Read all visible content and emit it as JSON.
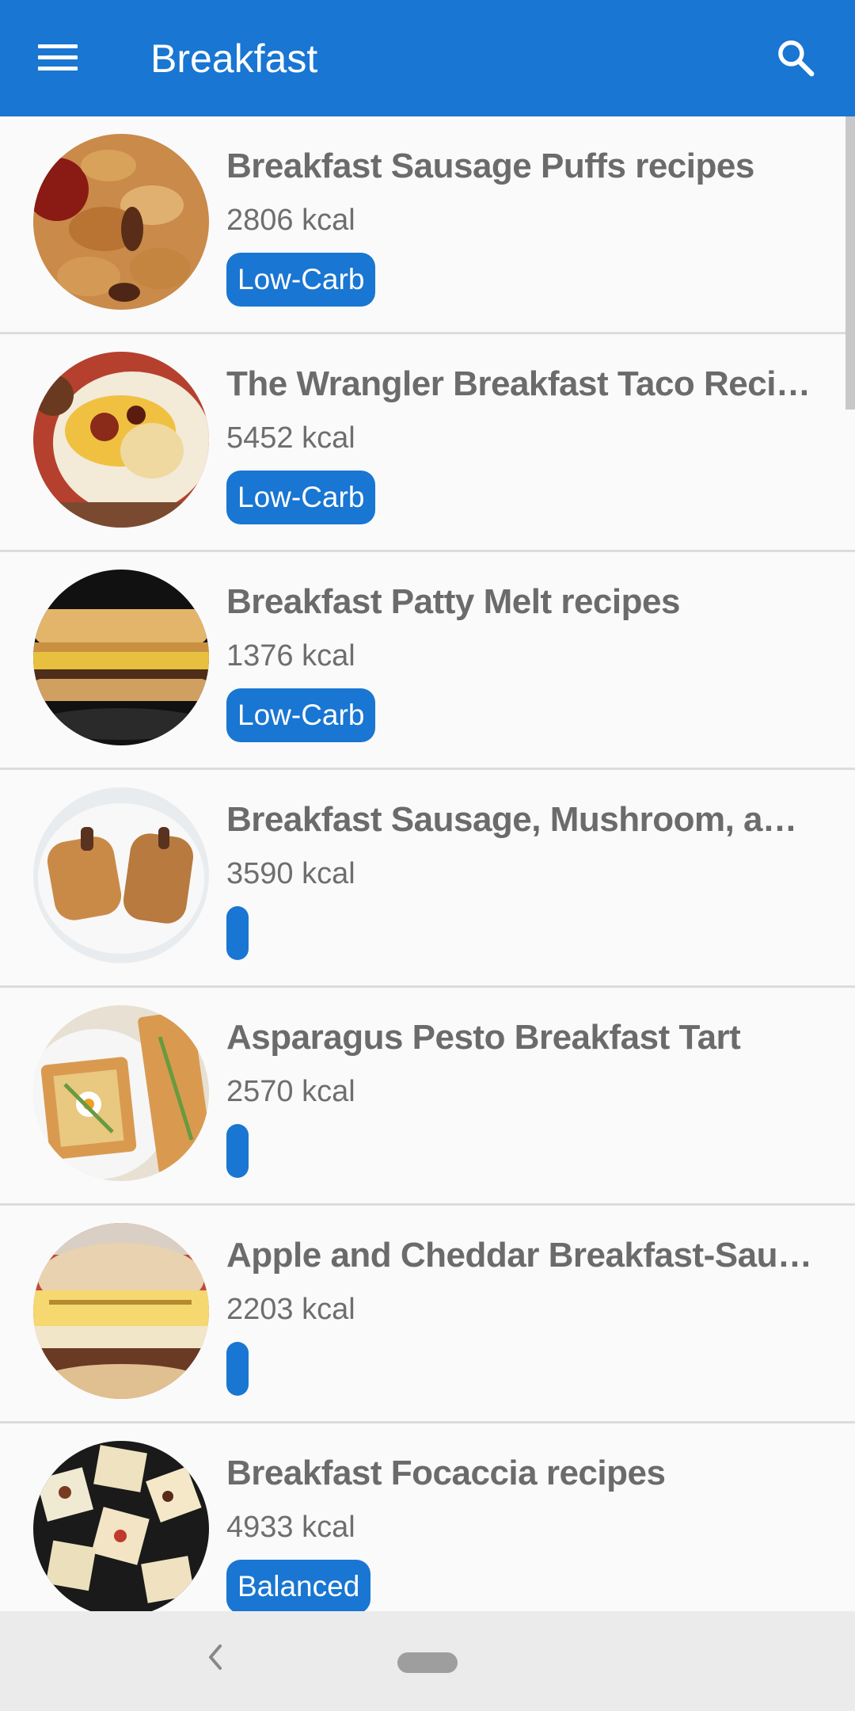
{
  "appbar": {
    "title": "Breakfast",
    "menu_icon": "menu-icon",
    "search_icon": "search-icon"
  },
  "recipes": [
    {
      "title": "Breakfast Sausage Puffs recipes",
      "kcal": "2806 kcal",
      "label": "Low-Carb"
    },
    {
      "title": "The Wrangler Breakfast Taco Recipe",
      "kcal": "5452 kcal",
      "label": "Low-Carb"
    },
    {
      "title": "Breakfast Patty Melt recipes",
      "kcal": "1376 kcal",
      "label": "Low-Carb"
    },
    {
      "title": "Breakfast Sausage, Mushroom, and C…",
      "kcal": "3590 kcal",
      "label": ""
    },
    {
      "title": "Asparagus Pesto Breakfast Tart",
      "kcal": "2570 kcal",
      "label": ""
    },
    {
      "title": "Apple and Cheddar Breakfast-Sausag…",
      "kcal": "2203 kcal",
      "label": ""
    },
    {
      "title": "Breakfast Focaccia recipes",
      "kcal": "4933 kcal",
      "label": "Balanced"
    }
  ],
  "colors": {
    "primary": "#1976d2",
    "text": "#6b6b6b"
  },
  "navbar": {
    "back_icon": "back-icon",
    "home_icon": "home-pill-icon"
  }
}
